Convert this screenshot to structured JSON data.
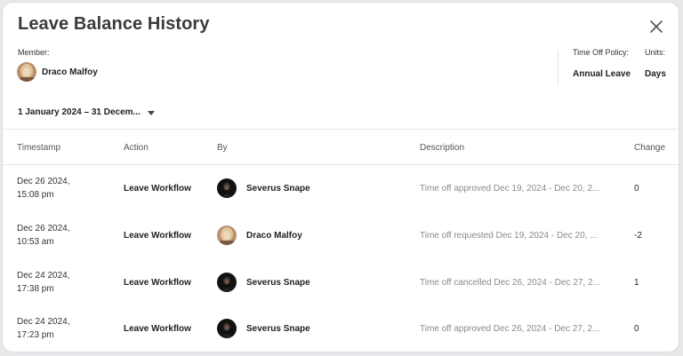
{
  "modal": {
    "title": "Leave Balance History",
    "close_icon": "close-icon"
  },
  "member": {
    "label": "Member:",
    "name": "Draco Malfoy",
    "avatar_icon": "avatar"
  },
  "policy": {
    "label": "Time Off Policy:",
    "value": "Annual Leave"
  },
  "units": {
    "label": "Units:",
    "value": "Days"
  },
  "date_range": {
    "value": "1 January 2024 – 31 Decem...",
    "icon": "chevron-down-icon"
  },
  "table": {
    "headers": [
      "Timestamp",
      "Action",
      "By",
      "Description",
      "Change"
    ],
    "rows": [
      {
        "ts_line1": "Dec 26 2024,",
        "ts_line2": "15:08 pm",
        "action": "Leave Workflow",
        "by": "Severus Snape",
        "description": "Time off approved Dec 19, 2024 - Dec 20, 2...",
        "change": "0"
      },
      {
        "ts_line1": "Dec 26 2024,",
        "ts_line2": "10:53 am",
        "action": "Leave Workflow",
        "by": "Draco Malfoy",
        "description": "Time off requested Dec 19, 2024 - Dec 20, ...",
        "change": "-2"
      },
      {
        "ts_line1": "Dec 24 2024,",
        "ts_line2": "17:38 pm",
        "action": "Leave Workflow",
        "by": "Severus Snape",
        "description": "Time off cancelled Dec 26, 2024 - Dec 27, 2...",
        "change": "1"
      },
      {
        "ts_line1": "Dec 24 2024,",
        "ts_line2": "17:23 pm",
        "action": "Leave Workflow",
        "by": "Severus Snape",
        "description": "Time off approved Dec 26, 2024 - Dec 27, 2...",
        "change": "0"
      }
    ]
  },
  "colors": {
    "text_primary": "#222222",
    "text_muted": "#8a8a8f",
    "divider": "#e6e6ea",
    "background": "#ffffff"
  }
}
